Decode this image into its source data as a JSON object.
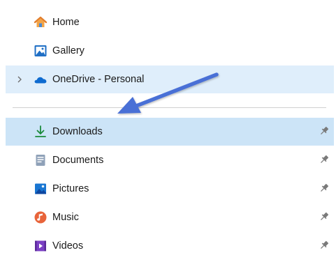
{
  "navigation": {
    "top_items": [
      {
        "label": "Home",
        "icon": "home-icon"
      },
      {
        "label": "Gallery",
        "icon": "gallery-icon"
      }
    ],
    "cloud_item": {
      "label": "OneDrive - Personal",
      "icon": "onedrive-cloud-icon",
      "expand_icon": "chevron-right-icon"
    },
    "quick_access": [
      {
        "label": "Downloads",
        "icon": "download-icon",
        "pinned": true,
        "selected": true
      },
      {
        "label": "Documents",
        "icon": "documents-icon",
        "pinned": true
      },
      {
        "label": "Pictures",
        "icon": "pictures-icon",
        "pinned": true
      },
      {
        "label": "Music",
        "icon": "music-icon",
        "pinned": true
      },
      {
        "label": "Videos",
        "icon": "videos-icon",
        "pinned": true
      }
    ]
  },
  "annotation": {
    "type": "arrow",
    "color": "#4a6fd6",
    "points_to": "Downloads"
  },
  "colors": {
    "selected_row": "#cce4f7",
    "hover_row": "#dfeefb",
    "accent": "#0a7d3a"
  }
}
